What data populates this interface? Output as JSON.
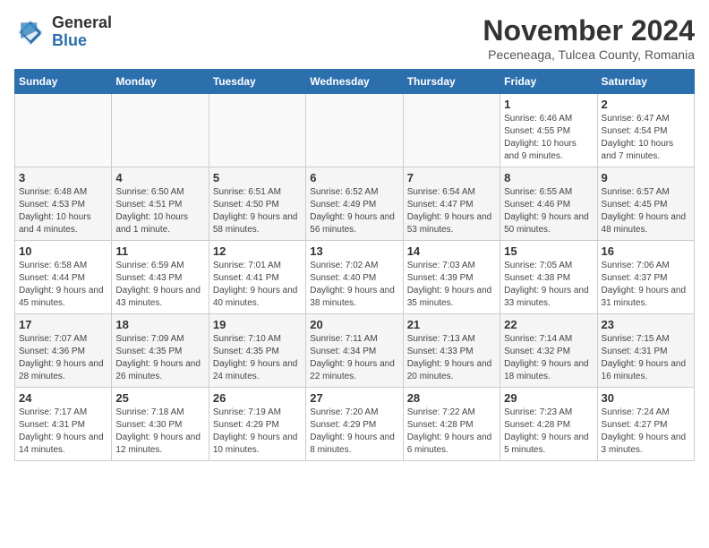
{
  "logo": {
    "text_general": "General",
    "text_blue": "Blue"
  },
  "title": "November 2024",
  "location": "Peceneaga, Tulcea County, Romania",
  "days_of_week": [
    "Sunday",
    "Monday",
    "Tuesday",
    "Wednesday",
    "Thursday",
    "Friday",
    "Saturday"
  ],
  "weeks": [
    [
      {
        "day": "",
        "info": ""
      },
      {
        "day": "",
        "info": ""
      },
      {
        "day": "",
        "info": ""
      },
      {
        "day": "",
        "info": ""
      },
      {
        "day": "",
        "info": ""
      },
      {
        "day": "1",
        "info": "Sunrise: 6:46 AM\nSunset: 4:55 PM\nDaylight: 10 hours and 9 minutes."
      },
      {
        "day": "2",
        "info": "Sunrise: 6:47 AM\nSunset: 4:54 PM\nDaylight: 10 hours and 7 minutes."
      }
    ],
    [
      {
        "day": "3",
        "info": "Sunrise: 6:48 AM\nSunset: 4:53 PM\nDaylight: 10 hours and 4 minutes."
      },
      {
        "day": "4",
        "info": "Sunrise: 6:50 AM\nSunset: 4:51 PM\nDaylight: 10 hours and 1 minute."
      },
      {
        "day": "5",
        "info": "Sunrise: 6:51 AM\nSunset: 4:50 PM\nDaylight: 9 hours and 58 minutes."
      },
      {
        "day": "6",
        "info": "Sunrise: 6:52 AM\nSunset: 4:49 PM\nDaylight: 9 hours and 56 minutes."
      },
      {
        "day": "7",
        "info": "Sunrise: 6:54 AM\nSunset: 4:47 PM\nDaylight: 9 hours and 53 minutes."
      },
      {
        "day": "8",
        "info": "Sunrise: 6:55 AM\nSunset: 4:46 PM\nDaylight: 9 hours and 50 minutes."
      },
      {
        "day": "9",
        "info": "Sunrise: 6:57 AM\nSunset: 4:45 PM\nDaylight: 9 hours and 48 minutes."
      }
    ],
    [
      {
        "day": "10",
        "info": "Sunrise: 6:58 AM\nSunset: 4:44 PM\nDaylight: 9 hours and 45 minutes."
      },
      {
        "day": "11",
        "info": "Sunrise: 6:59 AM\nSunset: 4:43 PM\nDaylight: 9 hours and 43 minutes."
      },
      {
        "day": "12",
        "info": "Sunrise: 7:01 AM\nSunset: 4:41 PM\nDaylight: 9 hours and 40 minutes."
      },
      {
        "day": "13",
        "info": "Sunrise: 7:02 AM\nSunset: 4:40 PM\nDaylight: 9 hours and 38 minutes."
      },
      {
        "day": "14",
        "info": "Sunrise: 7:03 AM\nSunset: 4:39 PM\nDaylight: 9 hours and 35 minutes."
      },
      {
        "day": "15",
        "info": "Sunrise: 7:05 AM\nSunset: 4:38 PM\nDaylight: 9 hours and 33 minutes."
      },
      {
        "day": "16",
        "info": "Sunrise: 7:06 AM\nSunset: 4:37 PM\nDaylight: 9 hours and 31 minutes."
      }
    ],
    [
      {
        "day": "17",
        "info": "Sunrise: 7:07 AM\nSunset: 4:36 PM\nDaylight: 9 hours and 28 minutes."
      },
      {
        "day": "18",
        "info": "Sunrise: 7:09 AM\nSunset: 4:35 PM\nDaylight: 9 hours and 26 minutes."
      },
      {
        "day": "19",
        "info": "Sunrise: 7:10 AM\nSunset: 4:35 PM\nDaylight: 9 hours and 24 minutes."
      },
      {
        "day": "20",
        "info": "Sunrise: 7:11 AM\nSunset: 4:34 PM\nDaylight: 9 hours and 22 minutes."
      },
      {
        "day": "21",
        "info": "Sunrise: 7:13 AM\nSunset: 4:33 PM\nDaylight: 9 hours and 20 minutes."
      },
      {
        "day": "22",
        "info": "Sunrise: 7:14 AM\nSunset: 4:32 PM\nDaylight: 9 hours and 18 minutes."
      },
      {
        "day": "23",
        "info": "Sunrise: 7:15 AM\nSunset: 4:31 PM\nDaylight: 9 hours and 16 minutes."
      }
    ],
    [
      {
        "day": "24",
        "info": "Sunrise: 7:17 AM\nSunset: 4:31 PM\nDaylight: 9 hours and 14 minutes."
      },
      {
        "day": "25",
        "info": "Sunrise: 7:18 AM\nSunset: 4:30 PM\nDaylight: 9 hours and 12 minutes."
      },
      {
        "day": "26",
        "info": "Sunrise: 7:19 AM\nSunset: 4:29 PM\nDaylight: 9 hours and 10 minutes."
      },
      {
        "day": "27",
        "info": "Sunrise: 7:20 AM\nSunset: 4:29 PM\nDaylight: 9 hours and 8 minutes."
      },
      {
        "day": "28",
        "info": "Sunrise: 7:22 AM\nSunset: 4:28 PM\nDaylight: 9 hours and 6 minutes."
      },
      {
        "day": "29",
        "info": "Sunrise: 7:23 AM\nSunset: 4:28 PM\nDaylight: 9 hours and 5 minutes."
      },
      {
        "day": "30",
        "info": "Sunrise: 7:24 AM\nSunset: 4:27 PM\nDaylight: 9 hours and 3 minutes."
      }
    ]
  ],
  "row_backgrounds": [
    "#ffffff",
    "#f5f5f5",
    "#ffffff",
    "#f5f5f5",
    "#ffffff"
  ]
}
